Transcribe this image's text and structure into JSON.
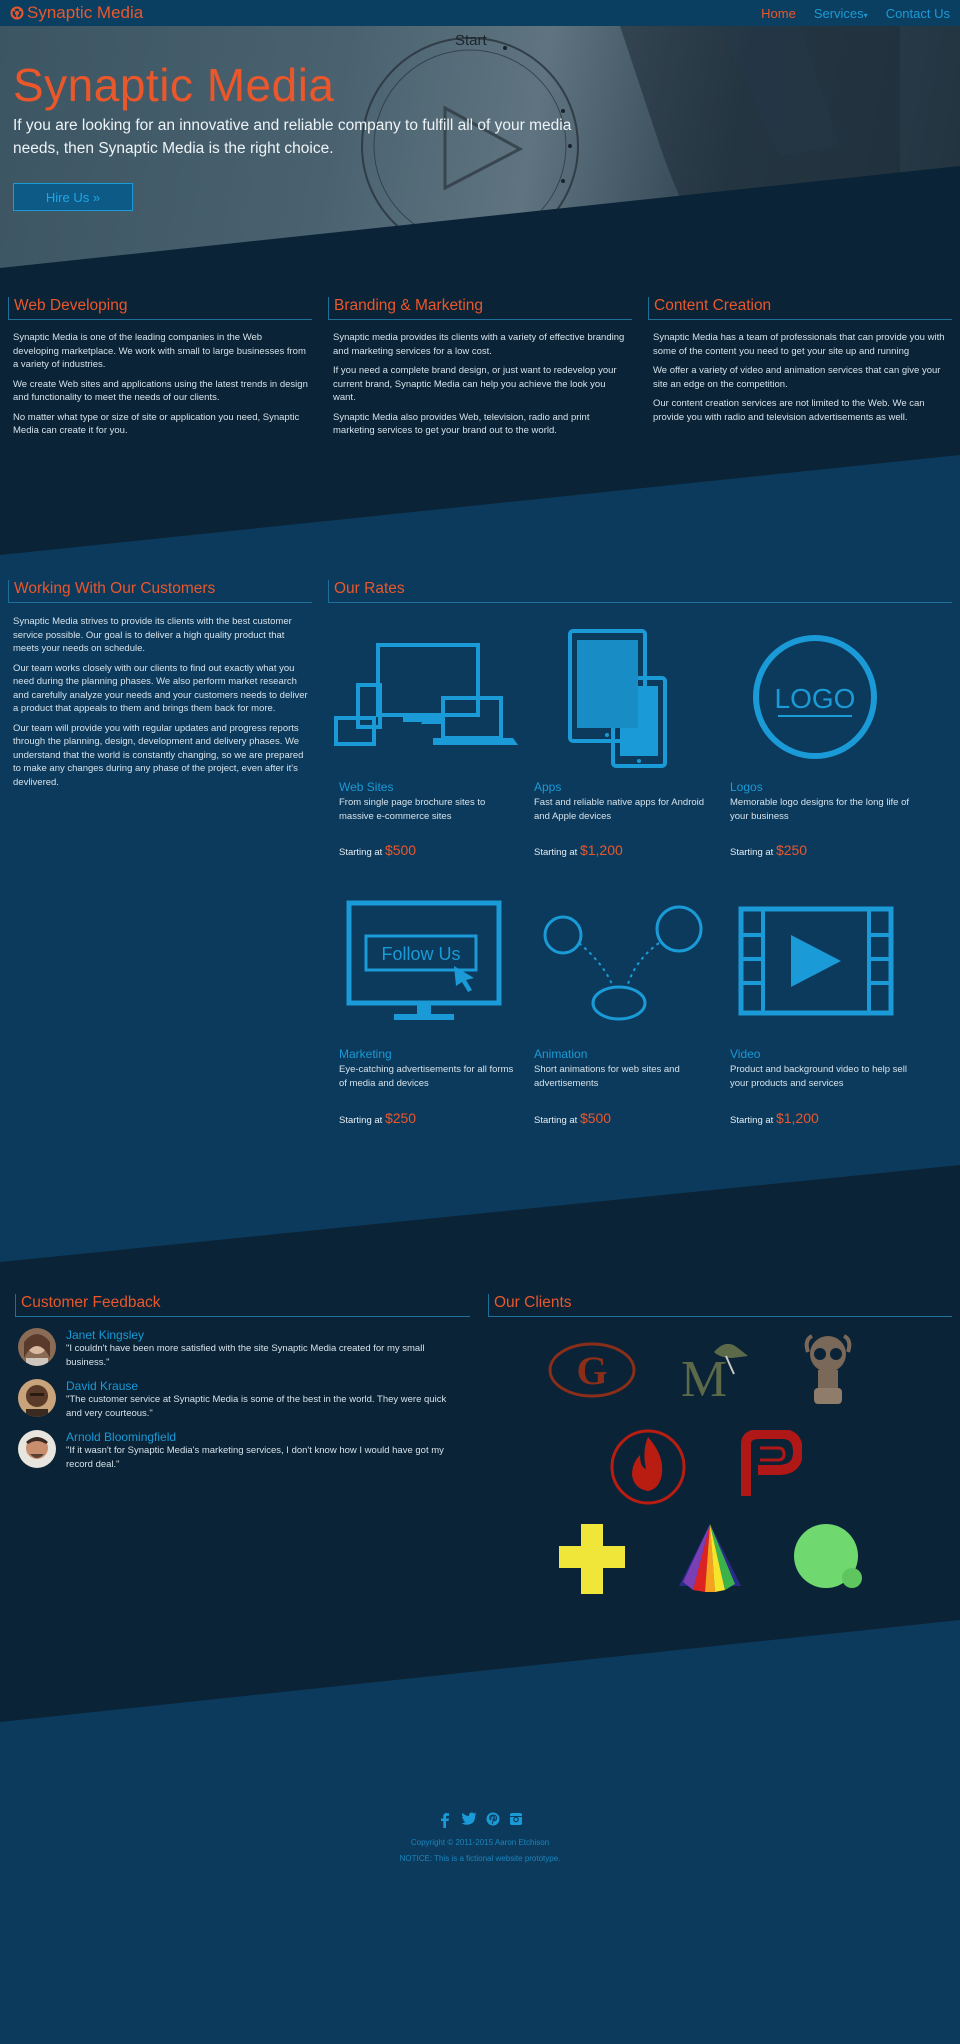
{
  "nav": {
    "brand": "Synaptic Media",
    "links": {
      "home": "Home",
      "services": "Services",
      "contact": "Contact Us"
    }
  },
  "hero": {
    "clock_label": "Start",
    "title": "Synaptic Media",
    "subtitle": "If you are looking for an innovative and reliable company to fulfill all of your media needs, then Synaptic Media is the right choice.",
    "button": "Hire Us »"
  },
  "services": [
    {
      "title": "Web Developing",
      "paragraphs": [
        "Synaptic Media is one of the leading companies in the Web developing marketplace. We work with small to large businesses from a variety of industries.",
        "We create Web sites and applications using the latest trends in design and functionality to meet the needs of our clients.",
        "No matter what type or size of site or application you need, Synaptic Media can create it for you."
      ]
    },
    {
      "title": "Branding & Marketing",
      "paragraphs": [
        "Synaptic media provides its clients with a variety of effective branding and marketing services for a low cost.",
        "If you need a complete brand design, or just want to redevelop your current brand, Synaptic Media can help you achieve the look you want.",
        "Synaptic Media also provides Web, television, radio and print marketing services to get your brand out to the world."
      ]
    },
    {
      "title": "Content Creation",
      "paragraphs": [
        "Synaptic Media has a team of professionals that can provide you with some of the content you need to get your site up and running",
        "We offer a variety of video and animation services that can give your site an edge on the competition.",
        "Our content creation services are not limited to the Web. We can provide you with radio and television advertisements as well."
      ]
    }
  ],
  "customers": {
    "title": "Working With Our Customers",
    "paragraphs": [
      "Synaptic Media strives to provide its clients with the best customer service possible. Our goal is to deliver a high quality product that meets your needs on schedule.",
      "Our team works closely with our clients to find out exactly what you need during the planning phases. We also perform market research and carefully analyze your needs and your customers needs to deliver a product that appeals to them and brings them back for more.",
      "Our team will provide you with regular updates and progress reports through the planning, design, development and delivery phases. We understand that the world is constantly changing, so we are prepared to make any changes during any phase of the project, even after it's devlivered."
    ]
  },
  "rates": {
    "title": "Our Rates",
    "starting_label": "Starting at",
    "items": [
      {
        "name": "Web Sites",
        "desc": "From single page brochure sites to massive e-commerce sites",
        "price": "$500",
        "icon": "devices-icon"
      },
      {
        "name": "Apps",
        "desc": "Fast and reliable native apps for Android and Apple devices",
        "price": "$1,200",
        "icon": "tablet-phone-icon"
      },
      {
        "name": "Logos",
        "desc": "Memorable logo designs for the long life of your business",
        "price": "$250",
        "icon": "logo-circle-icon",
        "icon_text": "LOGO"
      },
      {
        "name": "Marketing",
        "desc": "Eye-catching advertisements for all forms of media and devices",
        "price": "$250",
        "icon": "monitor-follow-icon",
        "icon_text": "Follow Us"
      },
      {
        "name": "Animation",
        "desc": "Short animations for web sites and advertisements",
        "price": "$500",
        "icon": "animation-path-icon"
      },
      {
        "name": "Video",
        "desc": "Product and background video to help sell your products and services",
        "price": "$1,200",
        "icon": "film-play-icon"
      }
    ]
  },
  "feedback": {
    "title": "Customer Feedback",
    "items": [
      {
        "name": "Janet Kingsley",
        "quote": "\"I couldn't have been more satisfied with the site Synaptic Media created for my small business.\""
      },
      {
        "name": "David Krause",
        "quote": "\"The customer service at Synaptic Media is some of the best in the world. They were quick and very courteous.\""
      },
      {
        "name": "Arnold Bloomingfield",
        "quote": "\"If it wasn't for Synaptic Media's marketing services, I don't know how I would have got my record deal.\""
      }
    ]
  },
  "clients": {
    "title": "Our Clients",
    "logos": [
      "g-logo",
      "m-hat-logo",
      "gasmask-logo",
      "flame-logo",
      "p-logo",
      "cross-logo",
      "prism-logo",
      "green-circle-logo"
    ],
    "logo_letters": {
      "g": "G",
      "m": "M"
    }
  },
  "footer": {
    "social": [
      "facebook-icon",
      "twitter-icon",
      "pinterest-icon",
      "instagram-icon"
    ],
    "copyright": "Copyright © 2011-2015 Aaron Etchison",
    "notice": "NOTICE: This is a fictional website prototype."
  },
  "colors": {
    "accent": "#e9572b",
    "link": "#1a9ad6",
    "bg_mid": "#0c3a5c",
    "bg_dark": "#0a2336"
  }
}
